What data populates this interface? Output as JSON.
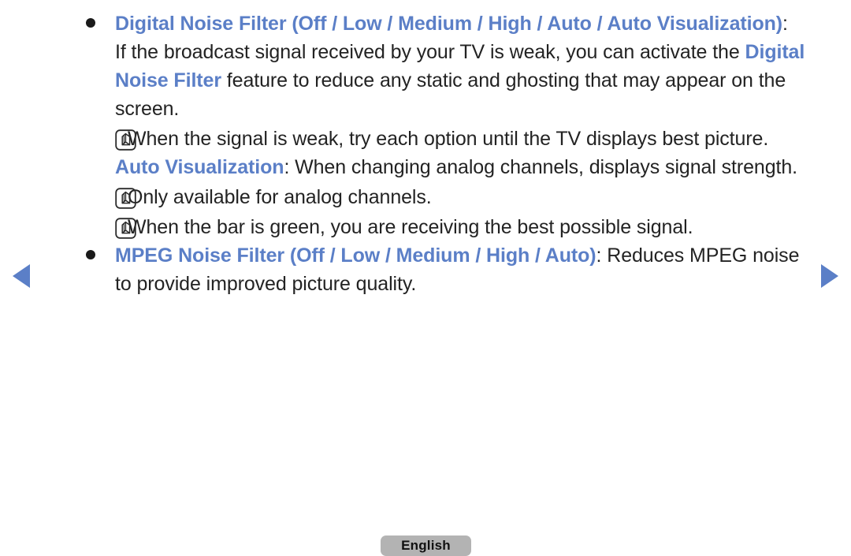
{
  "nav": {
    "prev_label": "Previous page",
    "next_label": "Next page"
  },
  "footer": {
    "language_label": "English"
  },
  "content": {
    "bullet_1": {
      "term": "Digital Noise Filter (Off / Low / Medium / High / Auto / Auto Visualization)",
      "term_suffix": ":",
      "body_before": "If the broadcast signal received by your TV is weak, you can activate the ",
      "body_highlight": "Digital Noise Filter",
      "body_after": " feature to reduce any static and ghosting that may appear on the screen.",
      "note_1": "When the signal is weak, try each option until the TV displays best picture.",
      "sub_term": "Auto Visualization",
      "sub_body": ": When changing analog channels, displays signal strength.",
      "note_2": "Only available for analog channels.",
      "note_3": "When the bar is green, you are receiving the best possible signal."
    },
    "bullet_2": {
      "term": "MPEG Noise Filter (Off / Low / Medium / High / Auto)",
      "term_suffix": ":",
      "body": " Reduces MPEG noise to provide improved picture quality."
    }
  }
}
